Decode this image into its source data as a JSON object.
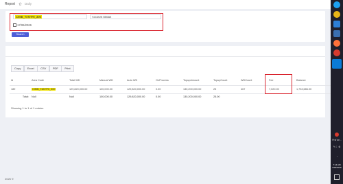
{
  "breadcrumb": {
    "title": "Report",
    "sub": "Daily"
  },
  "filters": {
    "code_value": "CIMB_TANTRI_300",
    "status_placeholder": "Account Status",
    "date_value": "17/06/2026",
    "search_label": "Search"
  },
  "export_buttons": [
    "Copy",
    "Excel",
    "CSV",
    "PDF",
    "Print"
  ],
  "table": {
    "headers": [
      "Id",
      "Area Code",
      "Total WD",
      "Manual WD",
      "Auto WD",
      "OnProcess",
      "TopupAmount",
      "TopupCount",
      "WDCount",
      "Fee",
      "Balance"
    ],
    "row": {
      "id": "189",
      "area_code": "CIMB_TANTRI_300",
      "total_wd": "129,820,000.00",
      "manual_wd": "100,000.00",
      "auto_wd": "129,820,000.00",
      "on_process": "0.00",
      "topup_amount": "130,200,000.00",
      "topup_count": "25",
      "wd_count": "467",
      "fee": "7,020.00",
      "balance": "1,733,686.00"
    },
    "total": {
      "label": "Total:",
      "area_code": "Null",
      "total_wd": "Null",
      "manual_wd": "100,000.00",
      "auto_wd": "129,820,000.00",
      "on_process": "0.00",
      "topup_amount": "130,200,000.00",
      "topup_count": "25.00"
    }
  },
  "showing_text": "Showing 1 to 1 of 1 entries",
  "footer_text": "2026 ©",
  "taskbar": {
    "label": "Prof de...",
    "time": "7:14 AM",
    "date": "5/18/2026",
    "colors": {
      "edge": "#1da1f2",
      "chrome": "#e8b618",
      "firefox": "#ff7139",
      "highlight": "#0a7bd8",
      "red": "#d63a2e"
    }
  }
}
